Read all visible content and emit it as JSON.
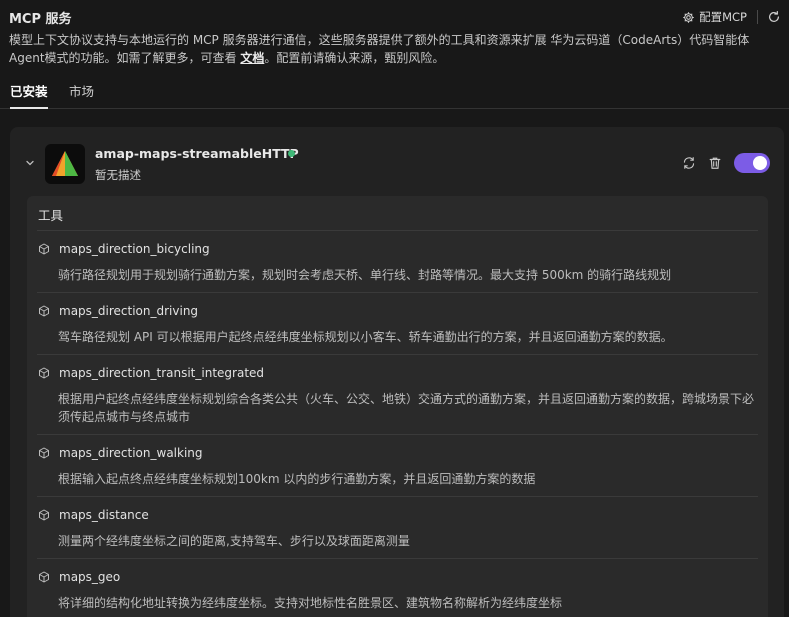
{
  "header": {
    "title": "MCP 服务",
    "config_label": "配置MCP"
  },
  "description": {
    "text_before": "模型上下文协议支持与本地运行的 MCP 服务器进行通信，这些服务器提供了额外的工具和资源来扩展 华为云码道（CodeArts）代码智能体 Agent模式的功能。如需了解更多，可查看 ",
    "link_text": "文档",
    "text_after": "。配置前请确认来源，甄别风险。"
  },
  "tabs": {
    "installed": "已安装",
    "market": "市场"
  },
  "server": {
    "name": "amap-maps-streamableHTTP",
    "description": "暂无描述",
    "status_color": "#3fb877",
    "enabled": true,
    "toggle_color": "#7c5ce6"
  },
  "tools": {
    "heading": "工具",
    "items": [
      {
        "name": "maps_direction_bicycling",
        "description": "骑行路径规划用于规划骑行通勤方案，规划时会考虑天桥、单行线、封路等情况。最大支持 500km 的骑行路线规划"
      },
      {
        "name": "maps_direction_driving",
        "description": "驾车路径规划 API 可以根据用户起终点经纬度坐标规划以小客车、轿车通勤出行的方案，并且返回通勤方案的数据。"
      },
      {
        "name": "maps_direction_transit_integrated",
        "description": "根据用户起终点经纬度坐标规划综合各类公共（火车、公交、地铁）交通方式的通勤方案，并且返回通勤方案的数据，跨城场景下必须传起点城市与终点城市"
      },
      {
        "name": "maps_direction_walking",
        "description": "根据输入起点终点经纬度坐标规划100km 以内的步行通勤方案，并且返回通勤方案的数据"
      },
      {
        "name": "maps_distance",
        "description": "测量两个经纬度坐标之间的距离,支持驾车、步行以及球面距离测量"
      },
      {
        "name": "maps_geo",
        "description": "将详细的结构化地址转换为经纬度坐标。支持对地标性名胜景区、建筑物名称解析为经纬度坐标"
      }
    ]
  }
}
